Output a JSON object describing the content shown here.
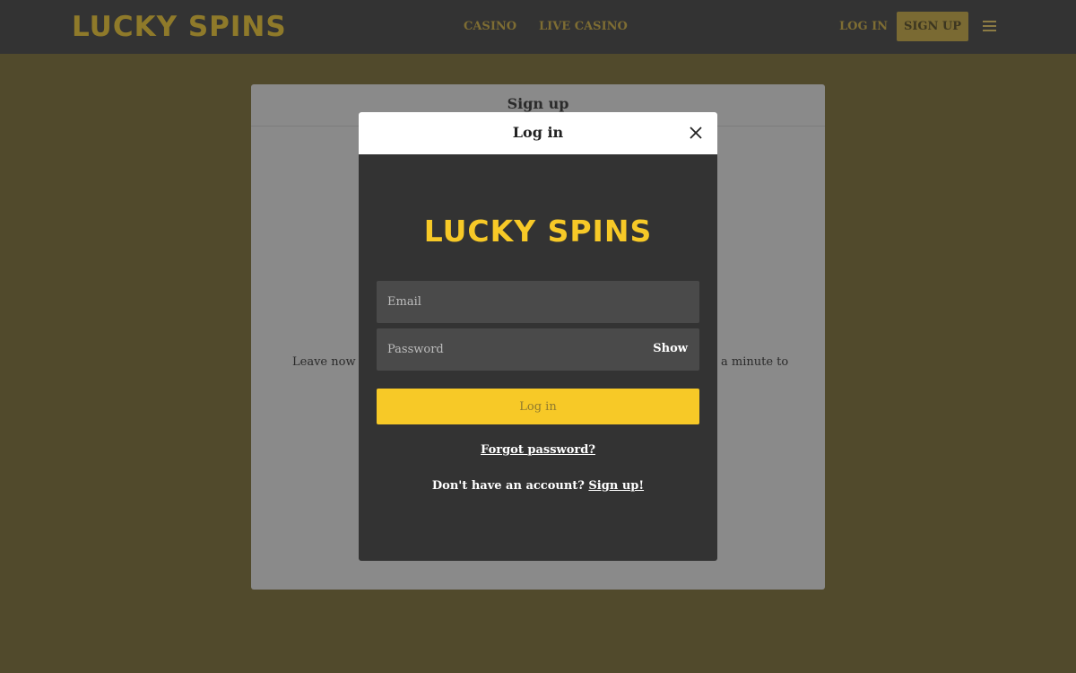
{
  "header": {
    "logo": "LUCKY SPINS",
    "nav": {
      "casino": "CASINO",
      "live_casino": "LIVE CASINO"
    },
    "login_label": "LOG IN",
    "signup_label": "SIGN UP",
    "menu_icon": "hamburger-menu-icon"
  },
  "background_card": {
    "title": "Sign up",
    "text_left": "Leave now a",
    "text_right": "a minute to"
  },
  "modal": {
    "title": "Log in",
    "close_icon": "close-icon",
    "logo": "LUCKY SPINS",
    "email": {
      "placeholder": "Email",
      "value": ""
    },
    "password": {
      "placeholder": "Password",
      "value": "",
      "show_label": "Show"
    },
    "login_button": "Log in",
    "forgot_password": "Forgot password?",
    "no_account_text": "Don't have an account?",
    "signup_link": "Sign up!"
  },
  "colors": {
    "brand_yellow": "#f7c927",
    "modal_bg": "#333333",
    "input_bg": "#4a4a4a",
    "overlay_tint": "#514a2c"
  }
}
